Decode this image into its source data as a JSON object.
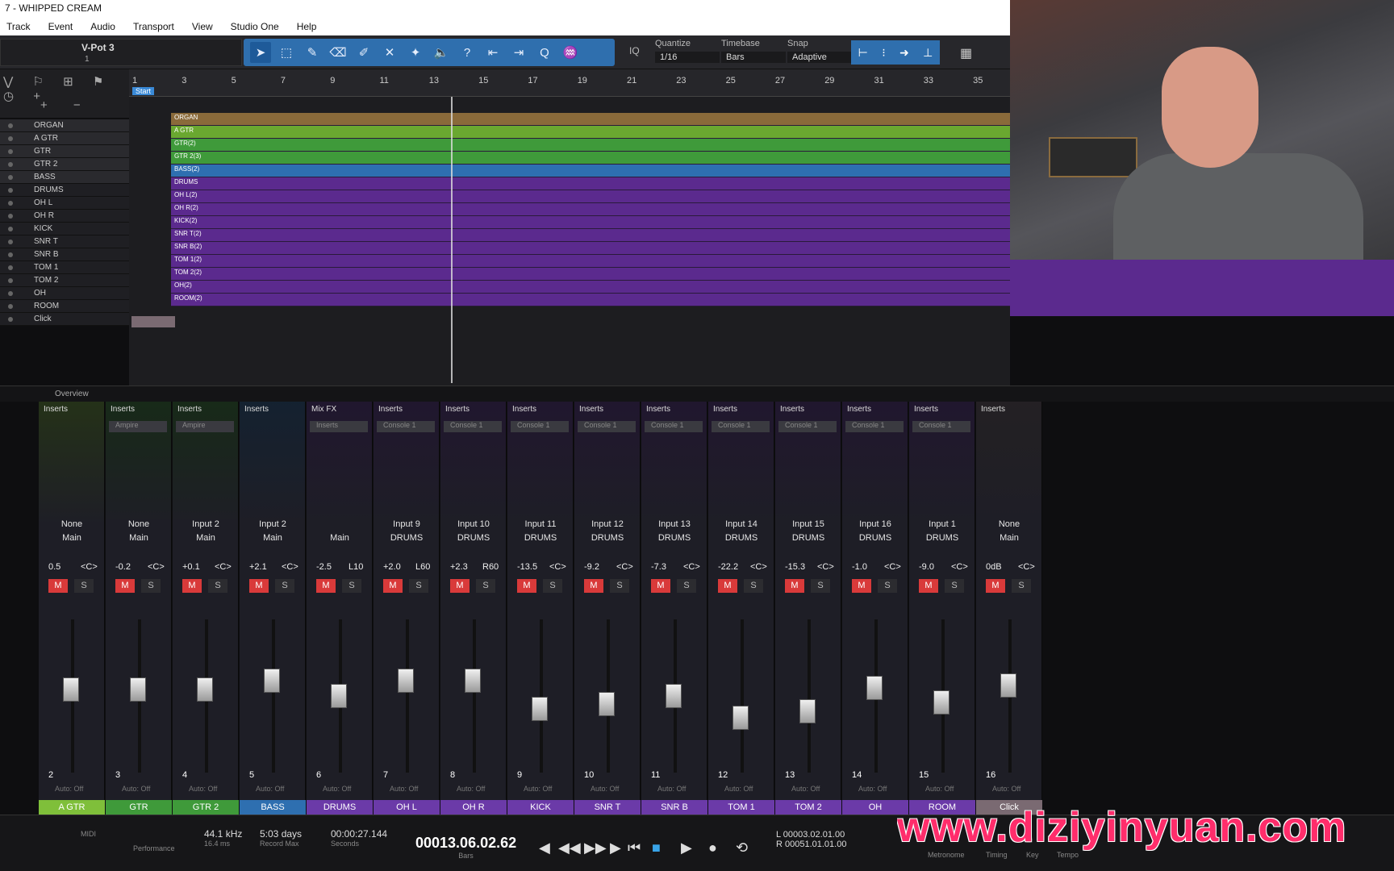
{
  "window": {
    "title": "7 - WHIPPED CREAM"
  },
  "menu": [
    "Track",
    "Event",
    "Audio",
    "Transport",
    "View",
    "Studio One",
    "Help"
  ],
  "toolbar": {
    "vpot": "V-Pot 3",
    "vpot_value": "1",
    "quantize_label": "Quantize",
    "quantize": "1/16",
    "timebase_label": "Timebase",
    "timebase": "Bars",
    "snap_label": "Snap",
    "snap": "Adaptive",
    "iq": "IQ"
  },
  "ruler": [
    "1",
    "3",
    "5",
    "7",
    "9",
    "11",
    "13",
    "15",
    "17",
    "19",
    "21",
    "23",
    "25",
    "27",
    "29",
    "31",
    "33",
    "35"
  ],
  "start_marker": "Start",
  "tracks": [
    "ORGAN",
    "A GTR",
    "GTR",
    "GTR 2",
    "BASS",
    "DRUMS",
    "OH L",
    "OH R",
    "KICK",
    "SNR T",
    "SNR B",
    "TOM 1",
    "TOM 2",
    "OH",
    "ROOM",
    "Click"
  ],
  "lanes": [
    "ORGAN",
    "A GTR",
    "GTR(2)",
    "GTR 2(3)",
    "BASS(2)",
    "DRUMS",
    "OH L(2)",
    "OH R(2)",
    "KICK(2)",
    "SNR T(2)",
    "SNR B(2)",
    "TOM 1(2)",
    "TOM 2(2)",
    "OH(2)",
    "ROOM(2)"
  ],
  "overview": "Overview",
  "mixer": [
    {
      "ins": "Inserts",
      "plug": "",
      "inp": "None",
      "out": "Main",
      "vol": "0.5",
      "pan": "<C>",
      "num": "2",
      "name": "A GTR",
      "color": "#7fbf3a"
    },
    {
      "ins": "Inserts",
      "plug": "Ampire",
      "inp": "None",
      "out": "Main",
      "vol": "-0.2",
      "pan": "<C>",
      "num": "3",
      "name": "GTR",
      "color": "#3f9a3a"
    },
    {
      "ins": "Inserts",
      "plug": "Ampire",
      "inp": "Input 2",
      "out": "Main",
      "vol": "+0.1",
      "pan": "<C>",
      "num": "4",
      "name": "GTR 2",
      "color": "#3f9a3a"
    },
    {
      "ins": "Inserts",
      "plug": "",
      "inp": "Input 2",
      "out": "Main",
      "vol": "+2.1",
      "pan": "<C>",
      "num": "5",
      "name": "BASS",
      "color": "#2e6fb0"
    },
    {
      "ins": "Mix FX",
      "plug": "Inserts",
      "inp": "",
      "out": "Main",
      "vol": "-2.5",
      "pan": "L10",
      "num": "6",
      "name": "DRUMS",
      "color": "#6b3aa8"
    },
    {
      "ins": "Inserts",
      "plug": "Console 1",
      "inp": "Input 9",
      "out": "DRUMS",
      "vol": "+2.0",
      "pan": "L60",
      "num": "7",
      "name": "OH L",
      "color": "#6b3aa8"
    },
    {
      "ins": "Inserts",
      "plug": "Console 1",
      "inp": "Input 10",
      "out": "DRUMS",
      "vol": "+2.3",
      "pan": "R60",
      "num": "8",
      "name": "OH R",
      "color": "#6b3aa8"
    },
    {
      "ins": "Inserts",
      "plug": "Console 1",
      "inp": "Input 11",
      "out": "DRUMS",
      "vol": "-13.5",
      "pan": "<C>",
      "num": "9",
      "name": "KICK",
      "color": "#6b3aa8"
    },
    {
      "ins": "Inserts",
      "plug": "Console 1",
      "inp": "Input 12",
      "out": "DRUMS",
      "vol": "-9.2",
      "pan": "<C>",
      "num": "10",
      "name": "SNR T",
      "color": "#6b3aa8"
    },
    {
      "ins": "Inserts",
      "plug": "Console 1",
      "inp": "Input 13",
      "out": "DRUMS",
      "vol": "-7.3",
      "pan": "<C>",
      "num": "11",
      "name": "SNR B",
      "color": "#6b3aa8"
    },
    {
      "ins": "Inserts",
      "plug": "Console 1",
      "inp": "Input 14",
      "out": "DRUMS",
      "vol": "-22.2",
      "pan": "<C>",
      "num": "12",
      "name": "TOM 1",
      "color": "#6b3aa8"
    },
    {
      "ins": "Inserts",
      "plug": "Console 1",
      "inp": "Input 15",
      "out": "DRUMS",
      "vol": "-15.3",
      "pan": "<C>",
      "num": "13",
      "name": "TOM 2",
      "color": "#6b3aa8"
    },
    {
      "ins": "Inserts",
      "plug": "Console 1",
      "inp": "Input 16",
      "out": "DRUMS",
      "vol": "-1.0",
      "pan": "<C>",
      "num": "14",
      "name": "OH",
      "color": "#6b3aa8"
    },
    {
      "ins": "Inserts",
      "plug": "Console 1",
      "inp": "Input 1",
      "out": "DRUMS",
      "vol": "-9.0",
      "pan": "<C>",
      "num": "15",
      "name": "ROOM",
      "color": "#6b3aa8"
    },
    {
      "ins": "Inserts",
      "plug": "",
      "inp": "None",
      "out": "Main",
      "vol": "0dB",
      "pan": "<C>",
      "num": "16",
      "name": "Click",
      "color": "#7a6a72"
    }
  ],
  "fader_levels": [
    0.55,
    0.55,
    0.55,
    0.62,
    0.5,
    0.62,
    0.62,
    0.4,
    0.44,
    0.5,
    0.33,
    0.38,
    0.56,
    0.45,
    0.58
  ],
  "transport": {
    "midi": "MIDI",
    "perf": "Performance",
    "rate": "44.1 kHz",
    "latency": "16.4 ms",
    "days": "5:03 days",
    "record_max": "Record Max",
    "time": "00:00:27.144",
    "time_unit": "Seconds",
    "position": "00013.06.02.62",
    "position_unit": "Bars",
    "loop_l": "L 00003.02.01.00",
    "loop_r": "R 00051.01.01.00",
    "metronome": "Metronome",
    "timing": "Timing",
    "key": "Key",
    "tempo": "Tempo"
  },
  "watermark": "www.diziyinyuan.com"
}
